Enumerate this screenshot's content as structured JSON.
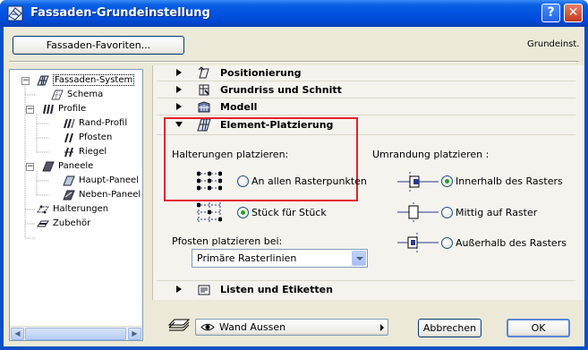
{
  "window": {
    "title": "Fassaden-Grundeinstellung",
    "help_symbol": "?",
    "close_symbol": "✕"
  },
  "header": {
    "favorites_button": "Fassaden-Favoriten...",
    "defaults_label": "Grundeinst."
  },
  "tree": {
    "items": [
      {
        "label": "Fassaden-System",
        "icon": "curtain-wall-icon",
        "expander": "−"
      },
      {
        "label": "Schema",
        "icon": "scheme-grid-icon"
      },
      {
        "label": "Profile",
        "icon": "frames-icon",
        "expander": "−"
      },
      {
        "label": "Rand-Profil",
        "icon": "boundary-frame-icon"
      },
      {
        "label": "Pfosten",
        "icon": "mullion-icon"
      },
      {
        "label": "Riegel",
        "icon": "transom-icon"
      },
      {
        "label": "Paneele",
        "icon": "panels-icon",
        "expander": "−"
      },
      {
        "label": "Haupt-Paneel",
        "icon": "main-panel-icon"
      },
      {
        "label": "Neben-Paneel",
        "icon": "distinct-panel-icon"
      },
      {
        "label": "Halterungen",
        "icon": "junction-icon"
      },
      {
        "label": "Zubehör",
        "icon": "accessory-icon"
      }
    ],
    "scroll_left": "◀",
    "scroll_right": "▶"
  },
  "sections": [
    {
      "label": "Positionierung",
      "icon": "positioning-icon",
      "state": "collapsed"
    },
    {
      "label": "Grundriss und Schnitt",
      "icon": "floorplan-section-icon",
      "state": "collapsed"
    },
    {
      "label": "Modell",
      "icon": "model-icon",
      "state": "collapsed"
    },
    {
      "label": "Element-Platzierung",
      "icon": "element-placement-icon",
      "state": "expanded"
    },
    {
      "label": "Listen und Etiketten",
      "icon": "listing-labels-icon",
      "state": "collapsed"
    }
  ],
  "placement": {
    "junctions_label": "Halterungen platzieren:",
    "junction_options": [
      {
        "label": "An allen Rasterpunkten",
        "selected": false
      },
      {
        "label": "Stück für Stück",
        "selected": true
      }
    ],
    "mullions_label": "Pfosten platzieren bei:",
    "mullions_value": "Primäre Rasterlinien",
    "boundary_label": "Umrandung platzieren :",
    "boundary_options": [
      {
        "label": "Innerhalb des Rasters",
        "selected": true
      },
      {
        "label": "Mittig auf Raster",
        "selected": false
      },
      {
        "label": "Außerhalb des Rasters",
        "selected": false
      }
    ]
  },
  "footer": {
    "layer_value": "Wand Aussen",
    "cancel_button": "Abbrechen",
    "ok_button": "OK"
  },
  "colors": {
    "titlebar": "#0053e1",
    "dialog_bg": "#ece9d8",
    "highlight_box": "#e5202a",
    "radio_selected": "#21a121"
  }
}
